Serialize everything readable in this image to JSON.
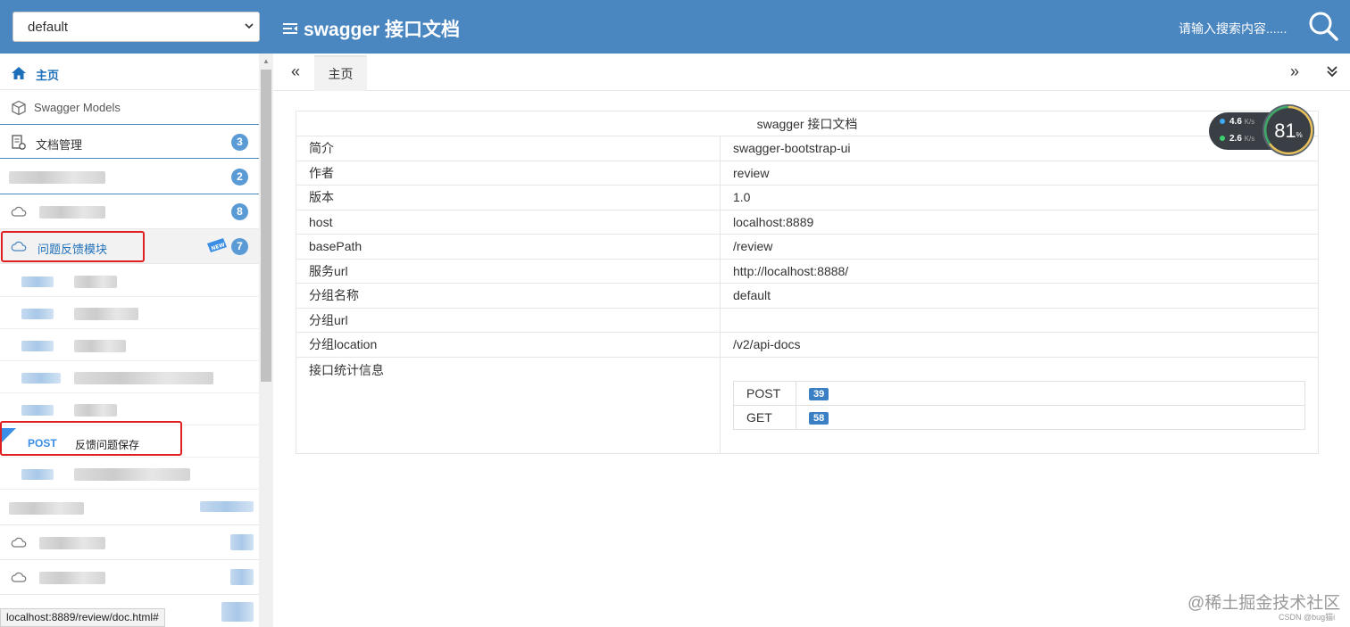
{
  "header": {
    "group_value": "default",
    "title": "swagger 接口文档",
    "search_placeholder": "请输入搜索内容......"
  },
  "sidebar": {
    "home": "主页",
    "models": "Swagger Models",
    "doc_manage": "文档管理",
    "doc_manage_count": "3",
    "group2_count": "2",
    "group3_count": "8",
    "feedback_module": "问题反馈模块",
    "feedback_count": "7",
    "new_tag": "NEW",
    "post_method": "POST",
    "post_desc": "反馈问题保存"
  },
  "statusbar": "localhost:8889/review/doc.html#",
  "tabs": {
    "home": "主页"
  },
  "info": {
    "caption": "swagger 接口文档",
    "rows": [
      {
        "k": "简介",
        "v": "swagger-bootstrap-ui"
      },
      {
        "k": "作者",
        "v": "review"
      },
      {
        "k": "版本",
        "v": "1.0"
      },
      {
        "k": "host",
        "v": "localhost:8889"
      },
      {
        "k": "basePath",
        "v": "/review"
      },
      {
        "k": "服务url",
        "v": "http://localhost:8888/"
      },
      {
        "k": "分组名称",
        "v": "default"
      },
      {
        "k": "分组url",
        "v": ""
      },
      {
        "k": "分组location",
        "v": "/v2/api-docs"
      }
    ],
    "stats_label": "接口统计信息",
    "stats": [
      {
        "method": "POST",
        "count": "39"
      },
      {
        "method": "GET",
        "count": "58"
      }
    ]
  },
  "speed": {
    "up": "4.6",
    "down": "2.6",
    "unit": "K/s",
    "cpu": "81",
    "pct": "%"
  },
  "watermark": "@稀土掘金技术社区",
  "watermark2": "CSDN @bug猫i",
  "colors": {
    "header": "#4a86c0",
    "badge": "#5b9bd5",
    "highlight": "#e02020"
  }
}
